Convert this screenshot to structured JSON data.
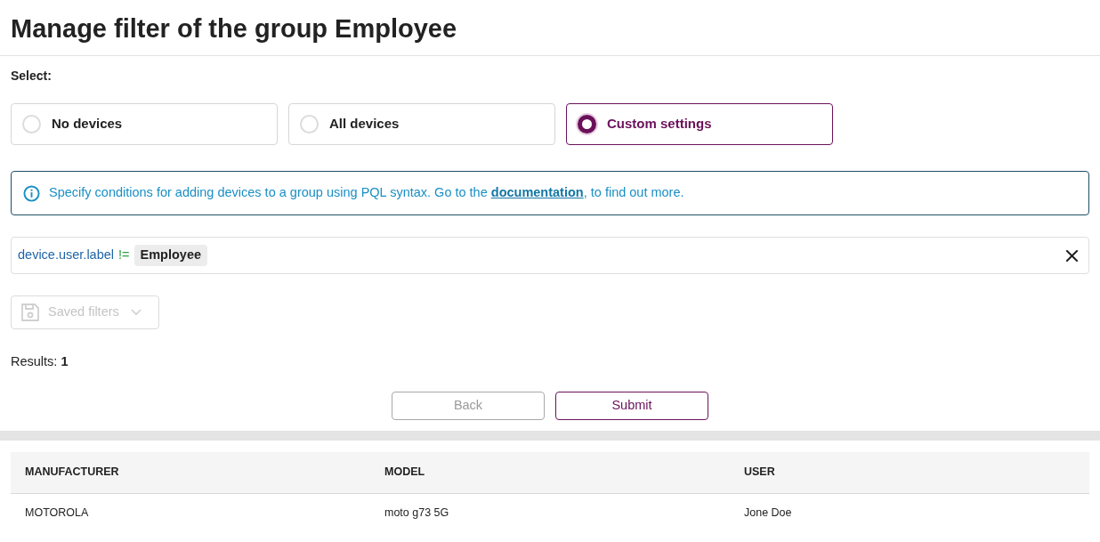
{
  "header": {
    "title": "Manage filter of the group Employee"
  },
  "selection": {
    "label": "Select:",
    "options": [
      {
        "label": "No devices",
        "selected": false
      },
      {
        "label": "All devices",
        "selected": false
      },
      {
        "label": "Custom settings",
        "selected": true
      }
    ]
  },
  "info": {
    "text": "Specify conditions for adding devices to a group using PQL syntax. Go to the ",
    "link": "documentation",
    "text_after": ", to find out more."
  },
  "filter": {
    "tokens": [
      {
        "kind": "field",
        "text": "device.user.label"
      },
      {
        "kind": "operator",
        "text": "!="
      },
      {
        "kind": "value",
        "text": "Employee"
      }
    ]
  },
  "saved_filters": {
    "label": "Saved filters",
    "disabled": true
  },
  "results": {
    "label": "Results:",
    "count": "1"
  },
  "actions": [
    {
      "label": "Back",
      "kind": "secondary",
      "disabled": true
    },
    {
      "label": "Submit",
      "kind": "primary",
      "disabled": false
    }
  ],
  "table": {
    "columns": [
      "MANUFACTURER",
      "MODEL",
      "USER"
    ],
    "rows": [
      [
        "MOTOROLA",
        "moto g73 5G",
        "Jone Doe"
      ]
    ]
  }
}
